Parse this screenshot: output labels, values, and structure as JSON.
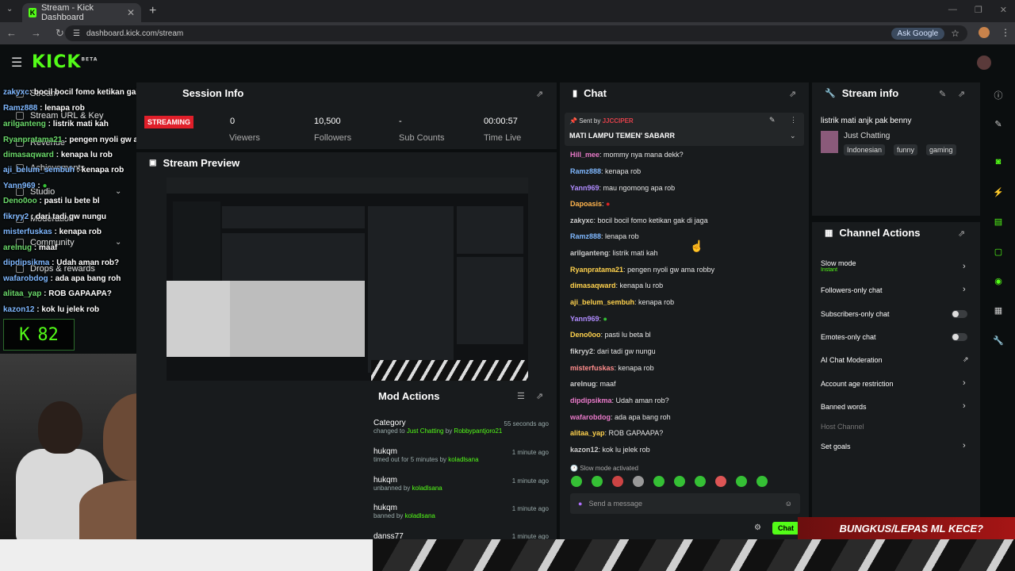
{
  "browser": {
    "tab_title": "Stream - Kick Dashboard",
    "url": "dashboard.kick.com/stream",
    "ask_google": "Ask Google"
  },
  "header": {
    "logo": "KICK",
    "logo_badge": "BETA"
  },
  "leftnav": {
    "items": [
      {
        "label": "Stream"
      },
      {
        "label": "Stream URL & Key"
      },
      {
        "label": "Revenue"
      },
      {
        "label": "Achievements"
      },
      {
        "label": "Studio"
      },
      {
        "label": "Moderation"
      },
      {
        "label": "Community"
      },
      {
        "label": "Drops & rewards"
      }
    ]
  },
  "overlay_chat": [
    {
      "user": "zakyxc",
      "text": "bocil bocil fomo ketikan gak di jaga"
    },
    {
      "user": "Ramz888",
      "text": "lenapa rob"
    },
    {
      "user": "arilganteng",
      "text": "listrik mati kah"
    },
    {
      "user": "Ryanpratama21",
      "text": "pengen nyoli gw ama robby"
    },
    {
      "user": "dimasaqward",
      "text": "kenapa lu rob"
    },
    {
      "user": "aji_belum_sembuh",
      "text": "kenapa rob"
    },
    {
      "user": "Yann969",
      "text": ""
    },
    {
      "user": "Deno0oo",
      "text": "pasti lu bete bl"
    },
    {
      "user": "fikryy2",
      "text": "dari tadi gw nungu"
    },
    {
      "user": "misterfuskas",
      "text": "kenapa rob"
    },
    {
      "user": "arelnug",
      "text": "maaf"
    },
    {
      "user": "dipdipsikma",
      "text": "Udah aman rob?"
    },
    {
      "user": "wafarobdog",
      "text": "ada apa bang roh"
    },
    {
      "user": "alitaa_yap",
      "text": "ROB GAPAAPA?"
    },
    {
      "user": "kazon12",
      "text": "kok lu jelek rob"
    }
  ],
  "viewer_overlay": "82",
  "session": {
    "title": "Session Info",
    "status": "STREAMING",
    "viewers": "0",
    "viewers_label": "Viewers",
    "followers": "10,500",
    "followers_label": "Followers",
    "subs": "-",
    "subs_label": "Sub Counts",
    "time": "00:00:57",
    "time_label": "Time Live"
  },
  "preview": {
    "title": "Stream Preview"
  },
  "mod_actions": {
    "title": "Mod Actions",
    "rows": [
      {
        "name": "Category",
        "sub_prefix": "changed to ",
        "sub_link": "Just Chatting",
        "sub_mid": " by ",
        "sub_user": "Robbypantjoro21",
        "time": "55 seconds ago"
      },
      {
        "name": "hukqm",
        "sub_prefix": "timed out for 5 minutes by ",
        "sub_link": "",
        "sub_mid": "",
        "sub_user": "koladlsana",
        "time": "1 minute ago"
      },
      {
        "name": "hukqm",
        "sub_prefix": "unbanned by ",
        "sub_link": "",
        "sub_mid": "",
        "sub_user": "koladlsana",
        "time": "1 minute ago"
      },
      {
        "name": "hukqm",
        "sub_prefix": "banned by ",
        "sub_link": "",
        "sub_mid": "",
        "sub_user": "koladlsana",
        "time": "1 minute ago"
      },
      {
        "name": "danss77",
        "sub_prefix": "",
        "sub_link": "",
        "sub_mid": "",
        "sub_user": "",
        "time": "1 minute ago"
      }
    ]
  },
  "chat": {
    "title": "Chat",
    "pinned_by_label": "Sent by",
    "pinned_by_user": "JJCCIPER",
    "pinned_text": "MATI LAMPU TEMEN' SABARR",
    "messages": [
      {
        "user": "Hill_mee",
        "color": "#e879c8",
        "text": "mommy nya mana dekk?"
      },
      {
        "user": "Ramz888",
        "color": "#7fb8ff",
        "text": "kenapa rob"
      },
      {
        "user": "Yann969",
        "color": "#b08cff",
        "text": "mau ngomong apa rob"
      },
      {
        "user": "Dapoasis",
        "color": "#ffb44d",
        "text": ""
      },
      {
        "user": "zakyxc",
        "color": "#cccccc",
        "text": "bocil bocil fomo ketikan gak di jaga"
      },
      {
        "user": "Ramz888",
        "color": "#7fb8ff",
        "text": "lenapa rob"
      },
      {
        "user": "arilganteng",
        "color": "#cccccc",
        "text": "listrik mati kah"
      },
      {
        "user": "Ryanpratama21",
        "color": "#ffd24d",
        "text": "pengen nyoli gw ama robby"
      },
      {
        "user": "dimasaqward",
        "color": "#ffd24d",
        "text": "kenapa lu rob"
      },
      {
        "user": "aji_belum_sembuh",
        "color": "#ffd24d",
        "text": "kenapa rob"
      },
      {
        "user": "Yann969",
        "color": "#b08cff",
        "text": ""
      },
      {
        "user": "Deno0oo",
        "color": "#ffd24d",
        "text": "pasti lu beta bl"
      },
      {
        "user": "fikryy2",
        "color": "#cccccc",
        "text": "dari tadi gw nungu"
      },
      {
        "user": "misterfuskas",
        "color": "#ff8c8c",
        "text": "kenapa rob"
      },
      {
        "user": "arelnug",
        "color": "#cccccc",
        "text": "maaf"
      },
      {
        "user": "dipdipsikma",
        "color": "#e879c8",
        "text": "Udah aman rob?"
      },
      {
        "user": "wafarobdog",
        "color": "#e879c8",
        "text": "ada apa bang roh"
      },
      {
        "user": "alitaa_yap",
        "color": "#ffd24d",
        "text": "ROB GAPAAPA?"
      },
      {
        "user": "kazon12",
        "color": "#cccccc",
        "text": "kok lu jelek rob"
      }
    ],
    "slow_mode_notice": "Slow mode activated",
    "input_placeholder": "Send a message",
    "send_label": "Chat"
  },
  "stream_info": {
    "title": "Stream info",
    "stream_title": "listrik mati anjk pak benny",
    "category": "Just Chatting",
    "tags": [
      "Indonesian",
      "funny",
      "gaming"
    ]
  },
  "channel_actions": {
    "title": "Channel Actions",
    "items": [
      {
        "label": "Slow mode",
        "sub": "Instant"
      },
      {
        "label": "Followers-only chat"
      },
      {
        "label": "Subscribers-only chat"
      },
      {
        "label": "Emotes-only chat"
      },
      {
        "label": "AI Chat Moderation"
      },
      {
        "label": "Account age restriction"
      },
      {
        "label": "Banned words"
      },
      {
        "label": "Host Channel"
      },
      {
        "label": "Set goals"
      }
    ]
  },
  "banner_text": "BUNGKUS/LEPAS ML KECE?"
}
